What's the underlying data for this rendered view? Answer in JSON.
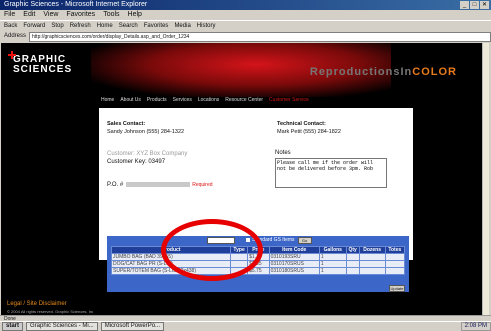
{
  "window": {
    "title": "Graphic Sciences - Microsoft Internet Explorer"
  },
  "menu": [
    "File",
    "Edit",
    "View",
    "Favorites",
    "Tools",
    "Help"
  ],
  "toolbar": [
    "Back",
    "Forward",
    "Stop",
    "Refresh",
    "Home",
    "Search",
    "Favorites",
    "Media",
    "History"
  ],
  "address": {
    "label": "Address",
    "url": "http://graphicsciences.com/order/display_Details.asp_and_Order_1234"
  },
  "site": {
    "logo_line1": "GRAPHIC",
    "logo_line2": "SCIENCES",
    "brand_prefix": "ReproductionsIn",
    "brand_color": "COLOR"
  },
  "nav": [
    "Home",
    "About Us",
    "Products",
    "Services",
    "Locations",
    "Resource Center",
    "Customer Service"
  ],
  "sidebar": {
    "footer_link": "Legal / Site Disclaimer",
    "copyright": "© 2004 All rights reserved. Graphic Sciences, Inc."
  },
  "order": {
    "sales_label": "Sales Contact:",
    "sales_value": "Sandy Johnson (555) 284-1322",
    "tech_label": "Technical Contact:",
    "tech_value": "Mark Petit (555) 284-1822",
    "customer_label": "Customer: XYZ Box Company",
    "customer_key": "Customer Key: 03497",
    "po_label": "P.O. #",
    "po_required": "Required",
    "notes_label": "Notes",
    "notes_value": "Please call me if the order will not be delivered before 3pm. Rob"
  },
  "table": {
    "view_select": "All Items",
    "standard_check": "Standard GS Items",
    "go_button": "Go",
    "columns": [
      "Product",
      "Type",
      "Price",
      "Item Code",
      "Gallons",
      "Qty",
      "Dozens",
      "Totes"
    ],
    "rows": [
      [
        "JUMBO BAG (BAD 39455)",
        "",
        "$1.75",
        "0310193SRU",
        "1",
        "",
        "",
        ""
      ],
      [
        "DOG/CAT BAG PR (S-LIB)",
        "",
        "$2.85",
        "0310170SRUS",
        "1",
        "",
        "",
        ""
      ],
      [
        "SUPER/TOTEM BAG (S-LIB 22x438)",
        "",
        "$5.75",
        "0310180SRUS",
        "1",
        "",
        "",
        ""
      ]
    ],
    "update_button": "Update"
  },
  "status": {
    "text": "Done"
  },
  "taskbar": {
    "start": "start",
    "tasks": [
      "Graphic Sciences - Mi...",
      "Microsoft PowerPo..."
    ],
    "clock": "2:08 PM"
  }
}
